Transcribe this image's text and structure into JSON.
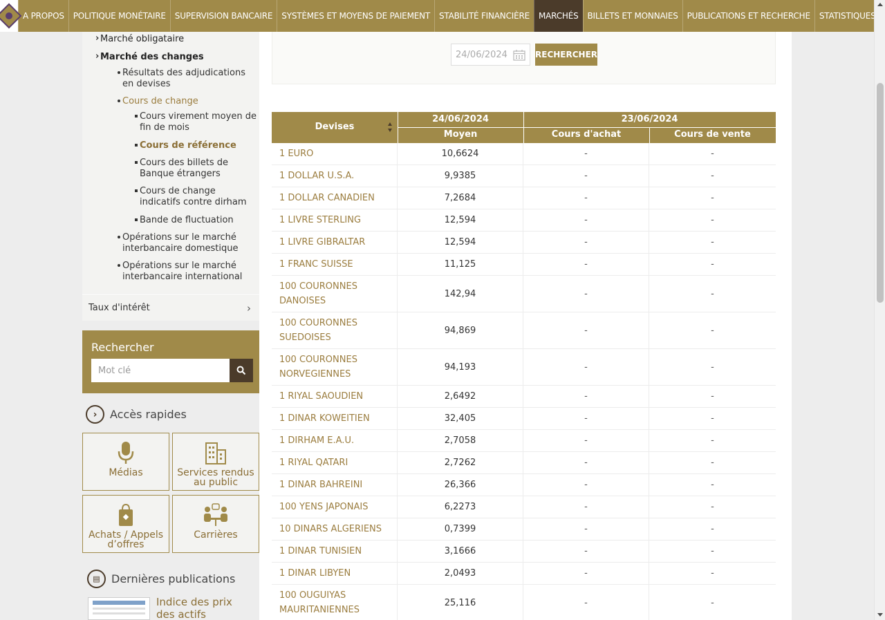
{
  "nav": {
    "items": [
      "A PROPOS",
      "POLITIQUE MONÉTAIRE",
      "SUPERVISION BANCAIRE",
      "SYSTÈMES ET MOYENS DE PAIEMENT",
      "STABILITÉ FINANCIÈRE",
      "MARCHÉS",
      "BILLETS ET MONNAIES",
      "PUBLICATIONS ET RECHERCHE",
      "STATISTIQUES"
    ],
    "active": "MARCHÉS"
  },
  "sidebar": {
    "menu": {
      "marche_obligataire": "Marché obligataire",
      "marche_changes": "Marché des changes",
      "resultats_adjudications": "Résultats des adjudications en devises",
      "cours_de_change": "Cours de change",
      "cours_virement": "Cours virement moyen de fin de mois",
      "cours_reference": "Cours de référence",
      "cours_billets": "Cours des billets de Banque étrangers",
      "cours_indicatifs": "Cours de change indicatifs contre dirham",
      "bande_fluctuation": "Bande de fluctuation",
      "ops_domestique": "Opérations sur le marché interbancaire domestique",
      "ops_international": "Opérations sur le marché interbancaire international"
    },
    "taux_interet": "Taux d'intérêt",
    "search": {
      "title": "Rechercher",
      "placeholder": "Mot clé"
    },
    "acces_rapides": {
      "title": "Accès rapides",
      "tiles": {
        "medias": "Médias",
        "services": "Services rendus au public",
        "achats": "Achats / Appels d’offres",
        "carrieres": "Carrières"
      }
    },
    "publications": {
      "title": "Dernières publications",
      "item_title": "Indice des prix des actifs immobiliers -"
    }
  },
  "date_search": {
    "value": "24/06/2024",
    "button": "RECHERCHER"
  },
  "table": {
    "header": {
      "devises": "Devises",
      "date1": "24/06/2024",
      "moyen": "Moyen",
      "date2": "23/06/2024",
      "achat": "Cours d'achat",
      "vente": "Cours de vente"
    },
    "rows": [
      {
        "devise": "1 EURO",
        "moyen": "10,6624",
        "achat": "-",
        "vente": "-"
      },
      {
        "devise": "1 DOLLAR U.S.A.",
        "moyen": "9,9385",
        "achat": "-",
        "vente": "-"
      },
      {
        "devise": "1 DOLLAR CANADIEN",
        "moyen": "7,2684",
        "achat": "-",
        "vente": "-"
      },
      {
        "devise": "1 LIVRE STERLING",
        "moyen": "12,594",
        "achat": "-",
        "vente": "-"
      },
      {
        "devise": "1 LIVRE GIBRALTAR",
        "moyen": "12,594",
        "achat": "-",
        "vente": "-"
      },
      {
        "devise": "1 FRANC SUISSE",
        "moyen": "11,125",
        "achat": "-",
        "vente": "-"
      },
      {
        "devise": "100 COURONNES DANOISES",
        "moyen": "142,94",
        "achat": "-",
        "vente": "-"
      },
      {
        "devise": "100 COURONNES SUEDOISES",
        "moyen": "94,869",
        "achat": "-",
        "vente": "-"
      },
      {
        "devise": "100 COURONNES NORVEGIENNES",
        "moyen": "94,193",
        "achat": "-",
        "vente": "-"
      },
      {
        "devise": "1 RIYAL SAOUDIEN",
        "moyen": "2,6492",
        "achat": "-",
        "vente": "-"
      },
      {
        "devise": "1 DINAR KOWEITIEN",
        "moyen": "32,405",
        "achat": "-",
        "vente": "-"
      },
      {
        "devise": "1 DIRHAM E.A.U.",
        "moyen": "2,7058",
        "achat": "-",
        "vente": "-"
      },
      {
        "devise": "1 RIYAL QATARI",
        "moyen": "2,7262",
        "achat": "-",
        "vente": "-"
      },
      {
        "devise": "1 DINAR BAHREINI",
        "moyen": "26,366",
        "achat": "-",
        "vente": "-"
      },
      {
        "devise": "100 YENS JAPONAIS",
        "moyen": "6,2273",
        "achat": "-",
        "vente": "-"
      },
      {
        "devise": "10 DINARS ALGERIENS",
        "moyen": "0,7399",
        "achat": "-",
        "vente": "-"
      },
      {
        "devise": "1 DINAR TUNISIEN",
        "moyen": "3,1666",
        "achat": "-",
        "vente": "-"
      },
      {
        "devise": "1 DINAR LIBYEN",
        "moyen": "2,0493",
        "achat": "-",
        "vente": "-"
      },
      {
        "devise": "100 OUGUIYAS MAURITANIENNES",
        "moyen": "25,116",
        "achat": "-",
        "vente": "-"
      }
    ]
  }
}
